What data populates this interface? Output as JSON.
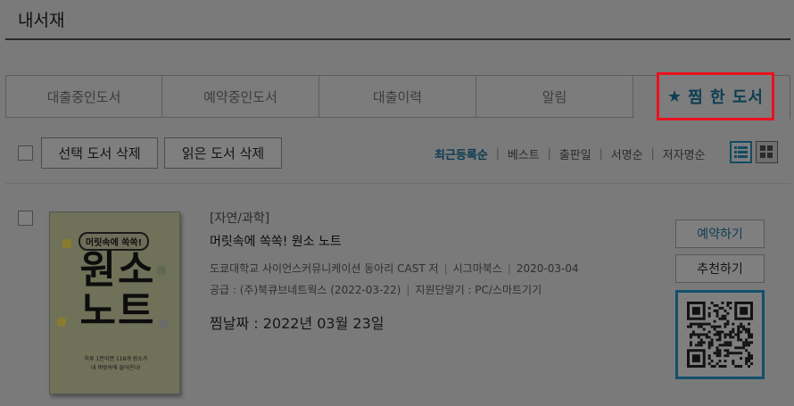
{
  "header": {
    "title": "내서재"
  },
  "tabs": [
    {
      "label": "대출중인도서"
    },
    {
      "label": "예약중인도서"
    },
    {
      "label": "대출이력"
    },
    {
      "label": "알림"
    },
    {
      "label": "찜 한 도서",
      "active": true
    }
  ],
  "active_tab_icon": "star-icon",
  "toolbar": {
    "delete_selected_label": "선택 도서 삭제",
    "delete_read_label": "읽은 도서 삭제",
    "sort_options": [
      "최근등록순",
      "베스트",
      "출판일",
      "서명순",
      "저자명순"
    ],
    "active_sort": "최근등록순",
    "view_icons": [
      "list-view-icon",
      "grid-view-icon"
    ]
  },
  "book": {
    "category": "[자연/과학]",
    "title": "머릿속에 쏙쏙! 원소 노트",
    "author": "도쿄대학교 사이언스커뮤니케이션 동아리 CAST 저",
    "publisher": "시그마북스",
    "pub_date": "2020-03-04",
    "supply": "공급 : (주)북큐브네트웍스 (2022-03-22)",
    "devices": "지원단말기 : PC/스마트기기",
    "wish_date": "찜날짜 : 2022년 03월 23일",
    "cover": {
      "tag": "머릿속에 쏙쏙!",
      "main_line1": "원소",
      "main_line2": "노트",
      "sub1": "하루 1분이면 118개 원소가",
      "sub2": "내 머릿속에 들어온다!"
    },
    "reserve_label": "예약하기",
    "recommend_label": "추천하기"
  },
  "colors": {
    "background": "#7a7a7a",
    "highlight_border": "#e8121d",
    "accent": "#0c3b50"
  }
}
